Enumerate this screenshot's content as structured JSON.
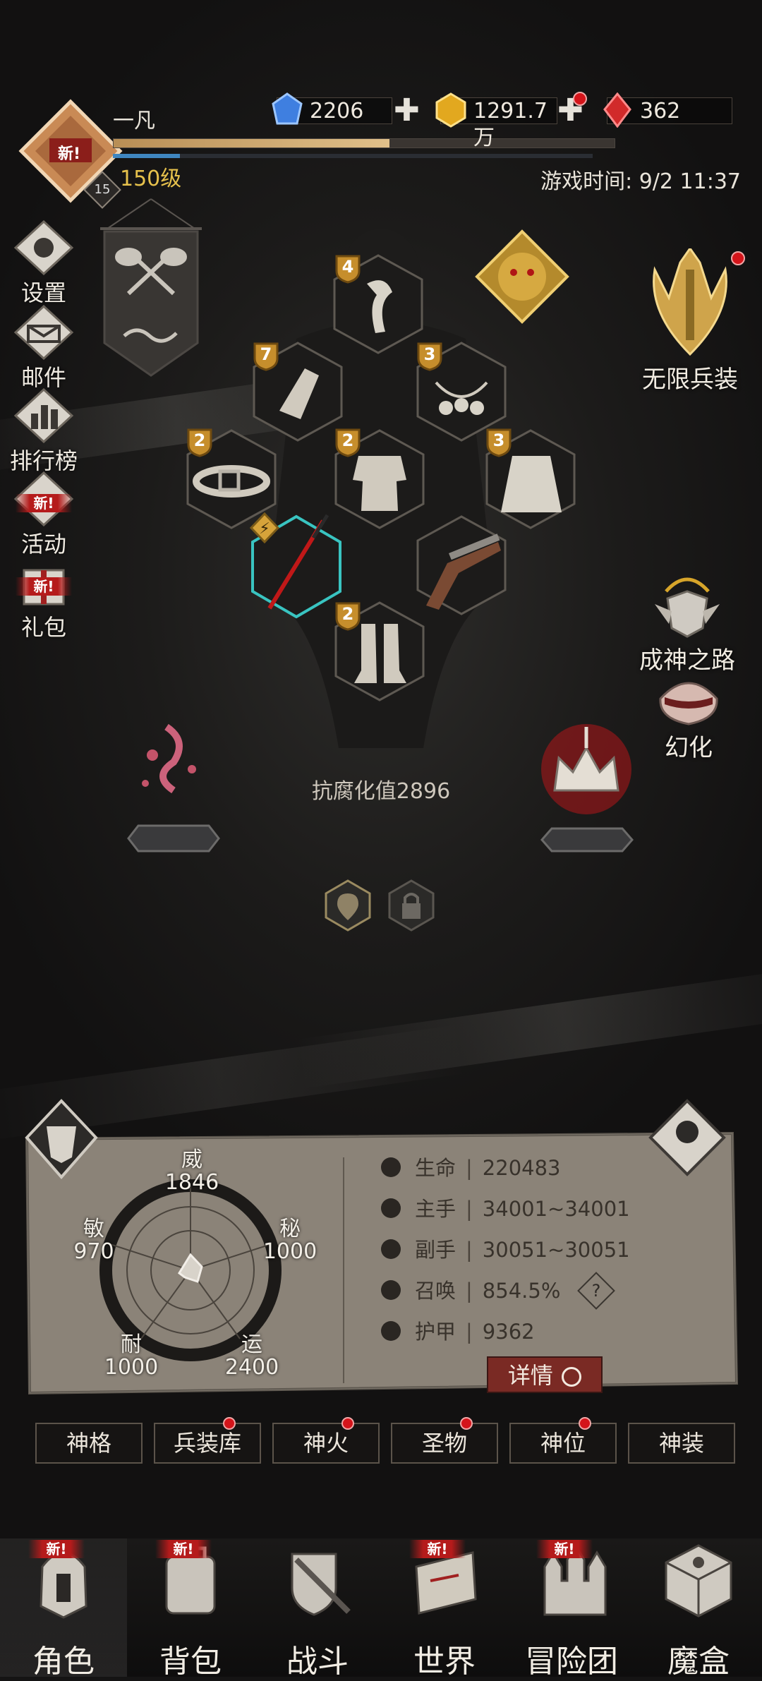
{
  "player": {
    "name": "一凡",
    "level_label": "150级",
    "badge_number": "15",
    "avatar_tag": "新!",
    "xp_fraction": 0.55,
    "mp_fraction": 0.14,
    "game_time": "游戏时间: 9/2 11:37"
  },
  "currency": [
    {
      "name": "blue-gem",
      "value": "2206",
      "plus": "✚",
      "has_dot": false
    },
    {
      "name": "gold-gem",
      "value": "1291.7万",
      "plus": "✚",
      "has_dot": true
    },
    {
      "name": "red-gem",
      "value": "362",
      "plus": "",
      "has_dot": false
    }
  ],
  "left_menu": [
    {
      "label": "设置",
      "icon": "gear-icon",
      "new": ""
    },
    {
      "label": "邮件",
      "icon": "mail-icon",
      "new": ""
    },
    {
      "label": "排行榜",
      "icon": "ranking-icon",
      "new": ""
    },
    {
      "label": "活动",
      "icon": "event-icon",
      "new": "新!"
    },
    {
      "label": "礼包",
      "icon": "gift-icon",
      "new": "新!"
    }
  ],
  "equipment": [
    {
      "slot": "scarf",
      "level": "4"
    },
    {
      "slot": "armguard",
      "level": "7"
    },
    {
      "slot": "necklace",
      "level": "3"
    },
    {
      "slot": "belt",
      "level": "2"
    },
    {
      "slot": "chest-armor",
      "level": "2"
    },
    {
      "slot": "cloak",
      "level": "3"
    },
    {
      "slot": "spear",
      "level": ""
    },
    {
      "slot": "pistol",
      "level": ""
    },
    {
      "slot": "greaves",
      "level": "2"
    }
  ],
  "right_icons": [
    {
      "label": "无限兵装",
      "icon": "infinite-arms-icon"
    },
    {
      "label": "成神之路",
      "icon": "path-to-godhood-icon"
    },
    {
      "label": "幻化",
      "icon": "transmog-icon"
    }
  ],
  "corruption_resist": "抗腐化值2896",
  "radar": {
    "威": "1846",
    "秘": "1000",
    "运": "2400",
    "耐": "1000",
    "敏": "970"
  },
  "radar_labels": {
    "wei": "威",
    "mi": "秘",
    "yun": "运",
    "nai": "耐",
    "min": "敏"
  },
  "stats": [
    {
      "label": "生命",
      "value": "220483",
      "icon": "heart-icon"
    },
    {
      "label": "主手",
      "value": "34001~34001",
      "icon": "sword-icon"
    },
    {
      "label": "副手",
      "value": "30051~30051",
      "icon": "offhand-icon"
    },
    {
      "label": "召唤",
      "value": "854.5%",
      "icon": "summon-icon"
    },
    {
      "label": "护甲",
      "value": "9362",
      "icon": "armor-icon"
    }
  ],
  "help_label": "?",
  "detail_button": "详情",
  "tabs": [
    {
      "label": "神格",
      "dot": false
    },
    {
      "label": "兵装库",
      "dot": true
    },
    {
      "label": "神火",
      "dot": true
    },
    {
      "label": "圣物",
      "dot": true
    },
    {
      "label": "神位",
      "dot": true
    },
    {
      "label": "神装",
      "dot": false
    }
  ],
  "bottom_nav": [
    {
      "label": "角色",
      "icon": "helmet-icon",
      "new": "新!",
      "active": true
    },
    {
      "label": "背包",
      "icon": "backpack-icon",
      "new": "新!",
      "active": false
    },
    {
      "label": "战斗",
      "icon": "shield-sword-icon",
      "new": "",
      "active": false
    },
    {
      "label": "世界",
      "icon": "map-scroll-icon",
      "new": "新!",
      "active": false
    },
    {
      "label": "冒险团",
      "icon": "castle-icon",
      "new": "新!",
      "active": false
    },
    {
      "label": "魔盒",
      "icon": "magic-box-icon",
      "new": "",
      "active": false
    }
  ],
  "colors": {
    "accent_gold": "#e6c14c",
    "new_red": "#b51b1b",
    "panel_parchment": "#8c8478",
    "detail_button": "#7a2a24"
  }
}
